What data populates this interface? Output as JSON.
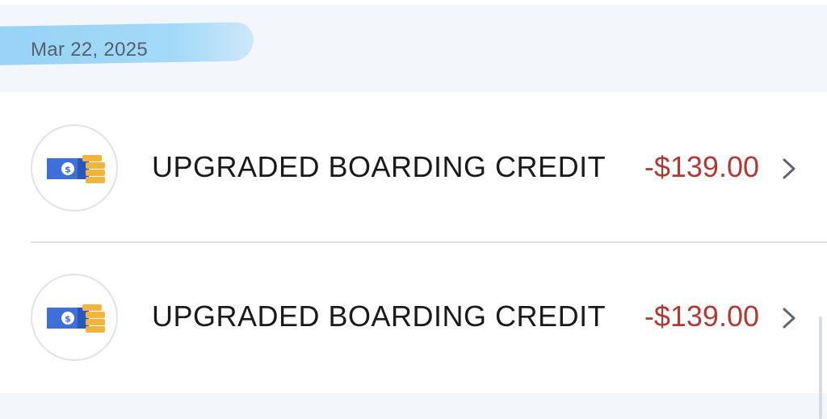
{
  "date_header": {
    "label": "Mar 22, 2025"
  },
  "transactions": [
    {
      "title": "UPGRADED BOARDING CREDIT",
      "amount": "-$139.00",
      "icon": "cash-coins-icon",
      "chevron": "chevron-right-icon"
    },
    {
      "title": "UPGRADED BOARDING CREDIT",
      "amount": "-$139.00",
      "icon": "cash-coins-icon",
      "chevron": "chevron-right-icon"
    }
  ],
  "colors": {
    "background": "#f3f6fa",
    "amount_negative": "#b13a35",
    "highlight": "#8fd2f6",
    "bill": "#3f6fd8",
    "coin": "#f2b43c"
  }
}
